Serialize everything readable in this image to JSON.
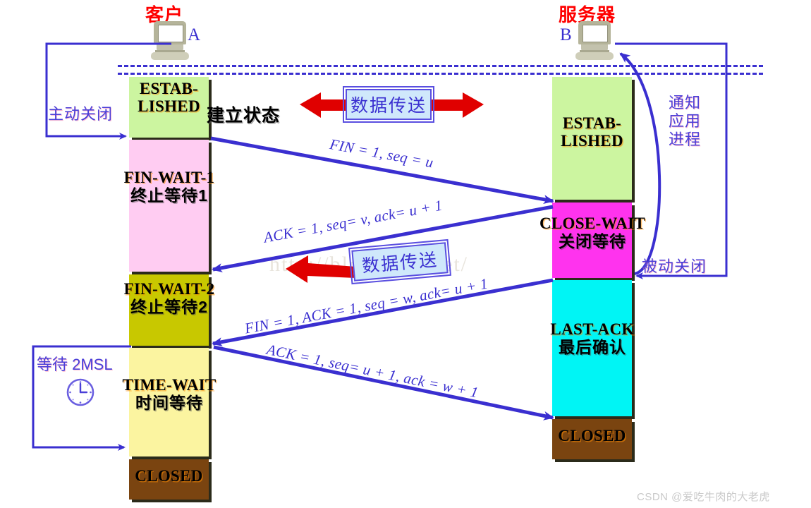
{
  "hosts": {
    "client": {
      "title": "客户",
      "letter": "A"
    },
    "server": {
      "title": "服务器",
      "letter": "B"
    }
  },
  "client_states": [
    {
      "en": "ESTAB-\nLISHED",
      "cn": "",
      "color": "#ccf5a0"
    },
    {
      "en": "FIN-WAIT-1",
      "cn": "终止等待1",
      "color": "#ffccf2"
    },
    {
      "en": "FIN-WAIT-2",
      "cn": "终止等待2",
      "color": "#c8c800"
    },
    {
      "en": "TIME-WAIT",
      "cn": "时间等待",
      "color": "#fbf4a0"
    },
    {
      "en": "CLOSED",
      "cn": "",
      "color": "#7a4410"
    }
  ],
  "server_states": [
    {
      "en": "ESTAB-\nLISHED",
      "cn": "",
      "color": "#ccf5a0"
    },
    {
      "en": "CLOSE-WAIT",
      "cn": "关闭等待",
      "color": "#ff33ee"
    },
    {
      "en": "LAST-ACK",
      "cn": "最后确认",
      "color": "#00f5f5"
    },
    {
      "en": "CLOSED",
      "cn": "",
      "color": "#7a4410"
    }
  ],
  "state_labels": {
    "estab_client_en1": "ESTAB-",
    "estab_client_en2": "LISHED",
    "estab_client_cn": "建立状态",
    "fin_wait_1_en": "FIN-WAIT-1",
    "fin_wait_1_cn": "终止等待1",
    "fin_wait_2_en": "FIN-WAIT-2",
    "fin_wait_2_cn": "终止等待2",
    "time_wait_en": "TIME-WAIT",
    "time_wait_cn": "时间等待",
    "closed_client": "CLOSED",
    "estab_server_en1": "ESTAB-",
    "estab_server_en2": "LISHED",
    "close_wait_en": "CLOSE-WAIT",
    "close_wait_cn": "关闭等待",
    "last_ack_en": "LAST-ACK",
    "last_ack_cn": "最后确认",
    "closed_server": "CLOSED"
  },
  "messages": [
    {
      "id": "fin1",
      "text": "FIN = 1, seq = u"
    },
    {
      "id": "ack1",
      "text": "ACK = 1, seq= v, ack= u + 1"
    },
    {
      "id": "finack",
      "text": "FIN = 1, ACK = 1, seq = w, ack= u + 1"
    },
    {
      "id": "ack2",
      "text": "ACK = 1, seq= u + 1, ack = w + 1"
    }
  ],
  "notes": {
    "active_close": "主动关闭",
    "passive_close": "被动关闭",
    "notify_app": "通知应用进程",
    "wait_2msl": "等待 2MSL"
  },
  "data_boxes": [
    {
      "id": "top",
      "text": "数据传送"
    },
    {
      "id": "bottom",
      "text": "数据传送"
    }
  ],
  "watermark": "http://blog.csdn.net/",
  "credit": "CSDN @爱吃牛肉的大老虎",
  "colors": {
    "blue_line": "#3a2fd0",
    "red_arrow": "#e00000",
    "title_red": "#ff0000",
    "established": "#ccf5a0",
    "fin_wait_1": "#ffccf2",
    "fin_wait_2": "#c8c800",
    "time_wait": "#fbf4a0",
    "closed": "#7a4410",
    "close_wait": "#ff33ee",
    "last_ack": "#00f5f5",
    "data_box_fill": "#cfe8fb"
  }
}
